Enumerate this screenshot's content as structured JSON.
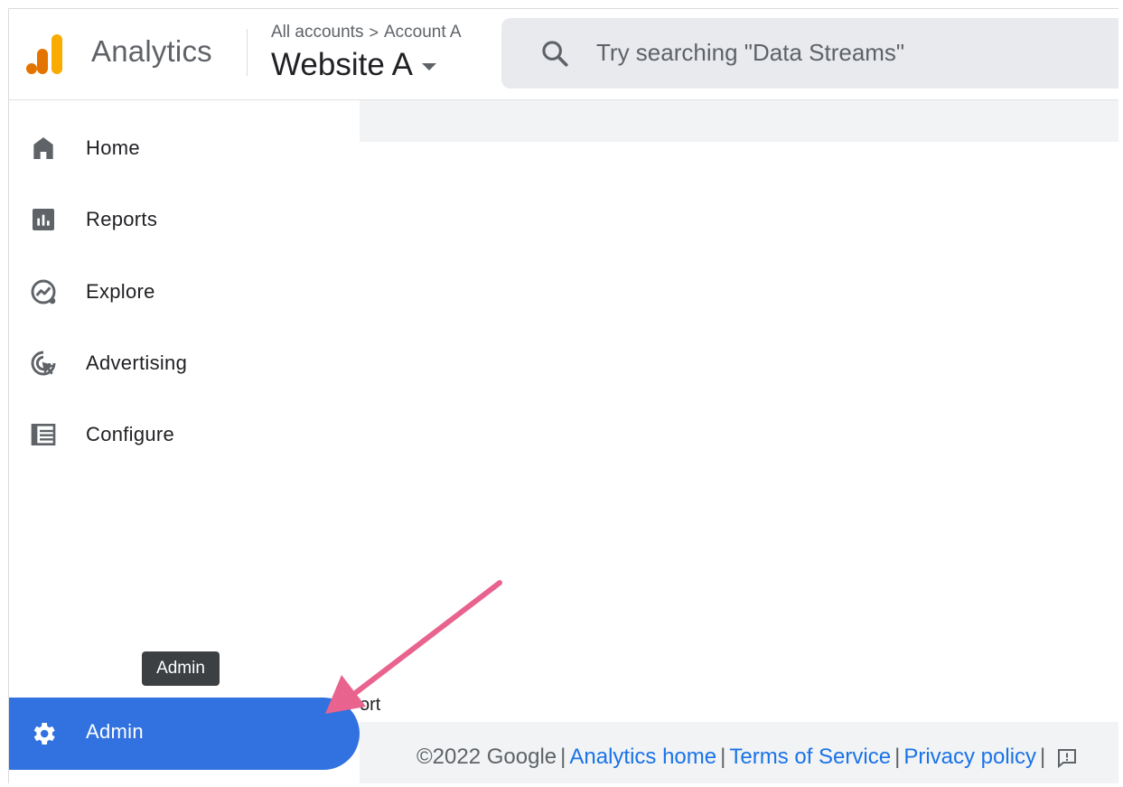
{
  "header": {
    "product_name": "Analytics",
    "breadcrumb": {
      "all_accounts": "All accounts",
      "separator": ">",
      "account": "Account A"
    },
    "property_name": "Website A",
    "search_placeholder": "Try searching \"Data Streams\""
  },
  "sidebar": {
    "items": [
      {
        "label": "Home",
        "icon": "home-icon"
      },
      {
        "label": "Reports",
        "icon": "reports-icon"
      },
      {
        "label": "Explore",
        "icon": "explore-icon"
      },
      {
        "label": "Advertising",
        "icon": "advertising-icon"
      },
      {
        "label": "Configure",
        "icon": "configure-icon"
      }
    ],
    "admin": {
      "label": "Admin",
      "icon": "gear-icon",
      "tooltip": "Admin"
    }
  },
  "main": {
    "partial_text": "ort"
  },
  "footer": {
    "copyright": "©2022 Google",
    "links": {
      "analytics_home": "Analytics home",
      "terms": "Terms of Service",
      "privacy": "Privacy policy"
    },
    "separator": "|"
  },
  "colors": {
    "admin_active": "#3171e0",
    "link": "#1a73e8",
    "annotation_arrow": "#e8638e",
    "logo_orange": "#f9ab00",
    "logo_dark_orange": "#e37400"
  }
}
